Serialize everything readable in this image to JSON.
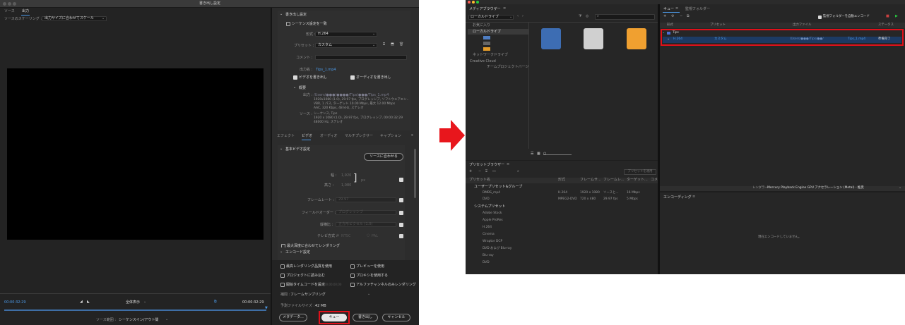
{
  "export": {
    "window_title": "書き出し設定",
    "tabs": [
      "ソース",
      "出力"
    ],
    "scaling_label": "ソースのスケーリング :",
    "scaling_value": "出力サイズに合わせてスケール",
    "time_left": "00:00:32:29",
    "zoom_value": "全体表示",
    "time_right": "00:00:32:29",
    "source_range_label": "ソース範囲 :",
    "source_range_value": "シーケンスイン/アウト間",
    "settings_header": "書き出し設定",
    "match_sequence": "シーケンス設定を一致",
    "format_label": "形式 :",
    "format_value": "H.264",
    "preset_label": "プリセット :",
    "preset_value": "カスタム",
    "comment_label": "コメント :",
    "output_label": "出力名 :",
    "output_value": "Tips_1.mp4",
    "export_video": "ビデオを書き出し",
    "export_audio": "オーディオを書き出し",
    "summary_header": "概要",
    "output_key": "出力 :",
    "output_summary": [
      "1920x1080 (1.0), 29.97 fps, プログレッシブ, ソフトウェアエン..",
      "VBR, 1 パス, ターゲット 10.00 Mbps, 最大 12.00 Mbps",
      "AAC, 320 Kbps, 48 kHz, ステレオ"
    ],
    "source_key": "ソース :",
    "source_summary": [
      "シーケンス, Tips",
      "1920 x 1080 (1.0), 29.97 fps, プログレッシブ, 00:00:32:29",
      "48000 Hz, ステレオ"
    ],
    "sub_tabs": [
      "エフェクト",
      "ビデオ",
      "オーディオ",
      "マルチプレクサー",
      "キャプション"
    ],
    "basic_video_header": "基本ビデオ設定",
    "match_source_btn": "ソースに合わせる",
    "width_label": "幅 :",
    "width_value": "1,920",
    "height_label": "高さ :",
    "height_value": "1,080",
    "px_label": "px",
    "framerate_label": "フレームレート :",
    "framerate_value": "29.97",
    "field_order_label": "フィールドオーダー :",
    "field_order_value": "プログレッシブ",
    "aspect_label": "縦横比 :",
    "aspect_value": "正方形ピクセル (1.0)",
    "tv_label": "テレビ方式 :",
    "ntsc": "NTSC",
    "pal": "PAL",
    "max_depth": "最大深度に合わせてレンダリング",
    "encode_header": "エンコード設定",
    "opt_max_quality": "最高レンダリング品質を使用",
    "opt_preview": "プレビューを使用",
    "opt_import": "プロジェクトに読み込む",
    "opt_proxy": "プロキシを使用する",
    "opt_start_tc": "開始タイムコードを設定",
    "opt_start_tc_value": "00;00;00;00",
    "opt_alpha": "アルファチャンネルのみレンダリング",
    "interp_label": "補間 :",
    "interp_value": "フレームサンプリング",
    "filesize_label": "予測ファイルサイズ :",
    "filesize_value": "42 MB",
    "btn_metadata": "メタデータ...",
    "btn_queue": "キュー",
    "btn_export": "書き出し",
    "btn_cancel": "キャンセル"
  },
  "media_encoder": {
    "media_browser_title": "メディアブラウザー",
    "local_drive_select": "ローカルドライブ",
    "tree_favorites": "お気に入り",
    "tree_local": "ローカルドライブ",
    "tree_network": "ネットワークドライブ",
    "tree_cc": "Creative Cloud",
    "tree_team": "チームプロジェクトバージ",
    "preset_browser_title": "プリセットブラウザー",
    "apply_preset_btn": "プリセットを適用",
    "preset_cols": [
      "プリセット名",
      "形式",
      "フレームサ...",
      "フレームレ...",
      "ターゲット...",
      "コメ"
    ],
    "user_presets_group": "ユーザープリセット&グループ",
    "user_presets": [
      {
        "name": "DMBS_mp4",
        "format": "H.264",
        "size": "1920 x 1080",
        "rate": "ソースと...",
        "target": "16 Mbps"
      },
      {
        "name": "DVD",
        "format": "MPEG2-DVD",
        "size": "720 x 480",
        "rate": "29.97 fps",
        "target": "5 Mbps"
      }
    ],
    "system_presets_group": "システムプリセット",
    "system_presets": [
      "Adobe Stock",
      "Apple ProRes",
      "H.264",
      "Cinema",
      "Wraptor DCP",
      "DVD および Blu-ray",
      "Blu-ray",
      "DVD"
    ],
    "queue_tab": "キュー",
    "watch_tab": "監視フォルダー",
    "auto_encode": "監視フォルダーを自動エンコード",
    "queue_cols": [
      "形式",
      "プリセット",
      "出力ファイル",
      "ステータス"
    ],
    "queue_group": "Tips",
    "queue_item": {
      "format": "H.264",
      "preset": "カスタム",
      "output": "Tips_1.mp4",
      "status": "準備完了"
    },
    "renderer_label": "レンダラー :",
    "renderer_value": "Mercury Playback Engine GPU アクセラレーション (Metal) - 推奨",
    "encoding_title": "エンコーディング",
    "encoding_status": "現在エンコードしていません。"
  },
  "colors": {
    "accent_red": "#e0101a",
    "arrow_red": "#e8161c",
    "link_blue": "#4c9ae8",
    "queue_green": "#27c93f"
  }
}
